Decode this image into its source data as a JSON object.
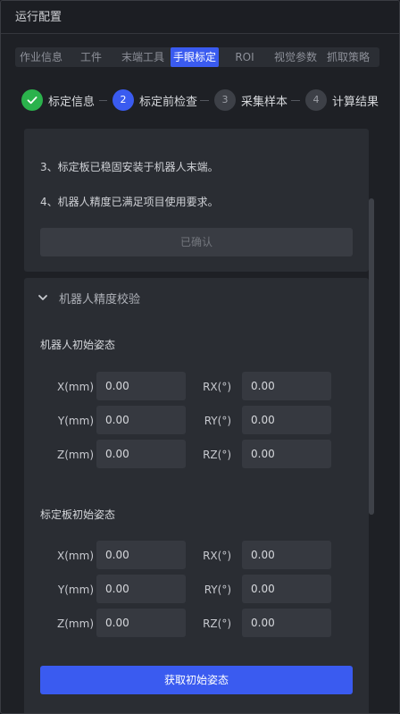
{
  "window": {
    "title": "运行配置"
  },
  "tabs": [
    {
      "label": "作业信息",
      "active": false
    },
    {
      "label": "工件",
      "active": false
    },
    {
      "label": "末端工具",
      "active": false
    },
    {
      "label": "手眼标定",
      "active": true
    },
    {
      "label": "ROI",
      "active": false
    },
    {
      "label": "视觉参数",
      "active": false
    },
    {
      "label": "抓取策略",
      "active": false
    }
  ],
  "steps": [
    {
      "number": "",
      "label": "标定信息",
      "status": "done",
      "icon": "check-icon"
    },
    {
      "number": "2",
      "label": "标定前检查",
      "status": "current"
    },
    {
      "number": "3",
      "label": "采集样本",
      "status": "pending"
    },
    {
      "number": "4",
      "label": "计算结果",
      "status": "pending"
    }
  ],
  "checklist": {
    "items": [
      "3、标定板已稳固安装于机器人末端。",
      "4、机器人精度已满足项目使用要求。"
    ],
    "confirm_button": "已确认"
  },
  "accuracy": {
    "title": "机器人精度校验",
    "robot_pose": {
      "title": "机器人初始姿态",
      "fields": [
        {
          "label": "X(mm)",
          "value": "0.00"
        },
        {
          "label": "RX(°)",
          "value": "0.00"
        },
        {
          "label": "Y(mm)",
          "value": "0.00"
        },
        {
          "label": "RY(°)",
          "value": "0.00"
        },
        {
          "label": "Z(mm)",
          "value": "0.00"
        },
        {
          "label": "RZ(°)",
          "value": "0.00"
        }
      ]
    },
    "board_pose": {
      "title": "标定板初始姿态",
      "fields": [
        {
          "label": "X(mm)",
          "value": "0.00"
        },
        {
          "label": "RX(°)",
          "value": "0.00"
        },
        {
          "label": "Y(mm)",
          "value": "0.00"
        },
        {
          "label": "RY(°)",
          "value": "0.00"
        },
        {
          "label": "Z(mm)",
          "value": "0.00"
        },
        {
          "label": "RZ(°)",
          "value": "0.00"
        }
      ]
    },
    "get_button": "获取初始姿态"
  },
  "colors": {
    "accent": "#3a5bf0",
    "success": "#2bb24c",
    "background": "#1e2025",
    "card": "#2a2d33"
  }
}
